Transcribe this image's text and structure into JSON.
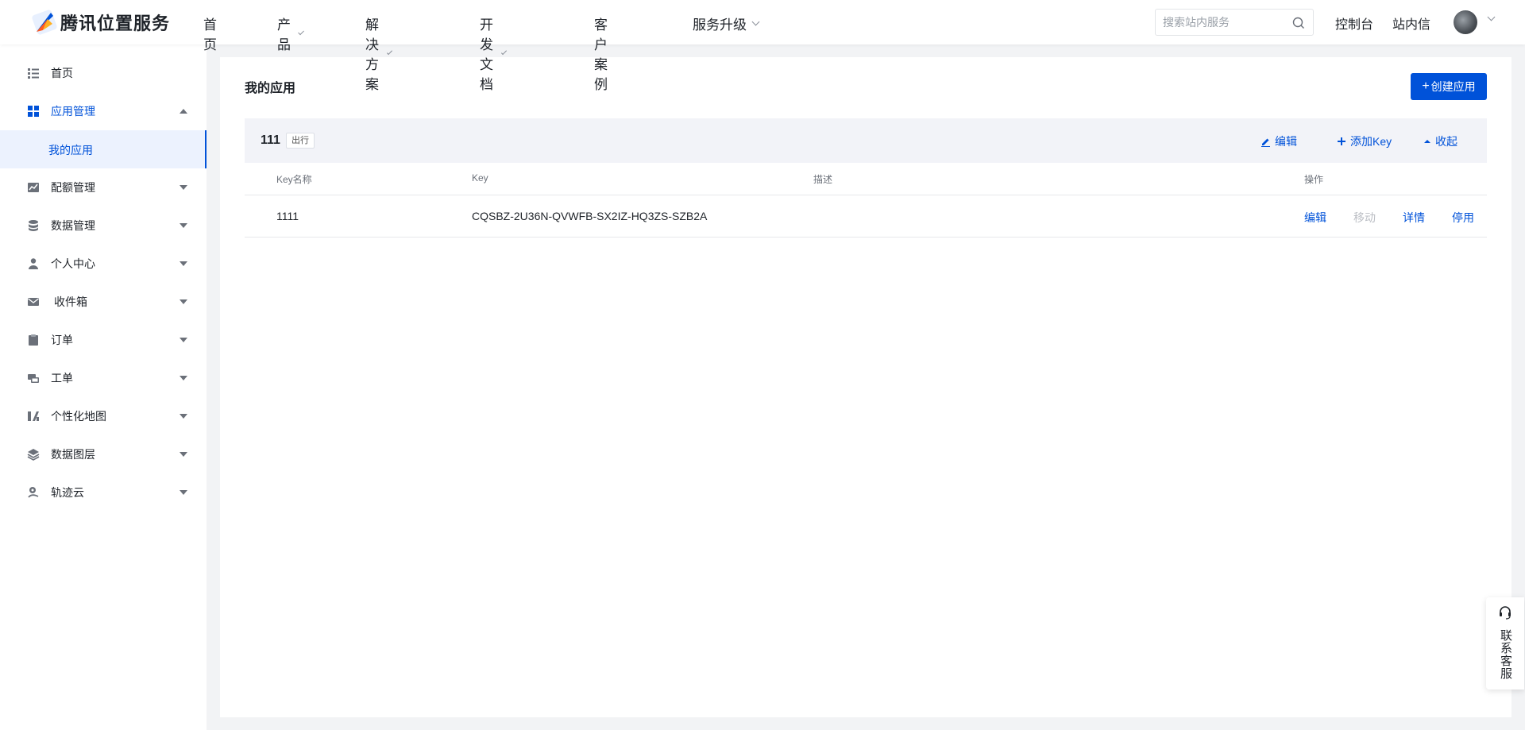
{
  "header": {
    "logo_text": "腾讯位置服务",
    "nav": [
      {
        "label": "首页",
        "has_dropdown": false
      },
      {
        "label": "产品",
        "has_dropdown": true
      },
      {
        "label": "解决方案",
        "has_dropdown": true
      },
      {
        "label": "开发文档",
        "has_dropdown": true
      },
      {
        "label": "客户案例",
        "has_dropdown": false
      },
      {
        "label": "服务升级",
        "has_dropdown": true
      }
    ],
    "search_placeholder": "搜索站内服务",
    "console_label": "控制台",
    "inbox_label": "站内信"
  },
  "sidebar": {
    "items": [
      {
        "label": "首页",
        "icon": "list-icon"
      },
      {
        "label": "应用管理",
        "icon": "grid-icon",
        "expanded": true
      },
      {
        "label": "配额管理",
        "icon": "chart-icon"
      },
      {
        "label": "数据管理",
        "icon": "database-icon"
      },
      {
        "label": "个人中心",
        "icon": "user-icon"
      },
      {
        "label": "收件箱",
        "icon": "mail-icon"
      },
      {
        "label": "订单",
        "icon": "clipboard-icon"
      },
      {
        "label": "工单",
        "icon": "ticket-icon"
      },
      {
        "label": "个性化地图",
        "icon": "map-style-icon"
      },
      {
        "label": "数据图层",
        "icon": "layers-icon"
      },
      {
        "label": "轨迹云",
        "icon": "track-cloud-icon"
      }
    ],
    "sub_items": [
      {
        "label": "我的应用",
        "active": true
      }
    ]
  },
  "main": {
    "title": "我的应用",
    "create_button": "创建应用",
    "app": {
      "name": "111",
      "tag": "出行",
      "actions": {
        "edit": "编辑",
        "add_key": "添加Key",
        "collapse": "收起"
      }
    },
    "table": {
      "columns": [
        "Key名称",
        "Key",
        "描述",
        "操作"
      ],
      "rows": [
        {
          "name": "1111",
          "key": "CQSBZ-2U36N-QVWFB-SX2IZ-HQ3ZS-SZB2A",
          "description": "",
          "ops": [
            "编辑",
            "移动",
            "详情",
            "停用"
          ]
        }
      ]
    }
  },
  "contact": {
    "label": "联系客服"
  },
  "colors": {
    "accent": "#0052d9",
    "disabled": "#bbbec4"
  }
}
